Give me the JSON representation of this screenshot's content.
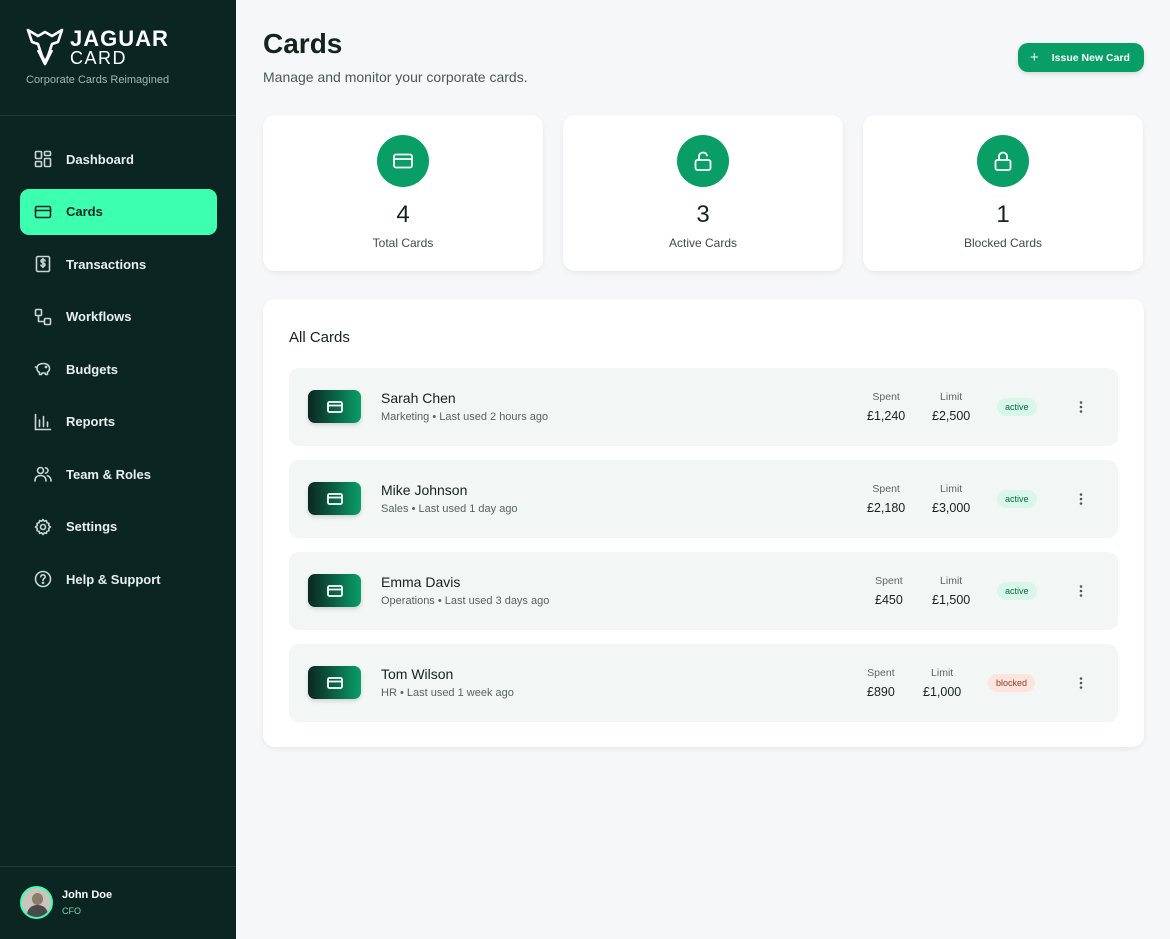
{
  "brand": {
    "name_line1": "JAGUAR",
    "name_line2": "CARD",
    "tagline": "Corporate Cards Reimagined"
  },
  "sidebar": {
    "items": [
      {
        "label": "Dashboard",
        "icon": "dashboard-icon",
        "active": false
      },
      {
        "label": "Cards",
        "icon": "credit-card-icon",
        "active": true
      },
      {
        "label": "Transactions",
        "icon": "receipt-dollar-icon",
        "active": false
      },
      {
        "label": "Workflows",
        "icon": "workflow-icon",
        "active": false
      },
      {
        "label": "Budgets",
        "icon": "piggy-bank-icon",
        "active": false
      },
      {
        "label": "Reports",
        "icon": "bar-chart-icon",
        "active": false
      },
      {
        "label": "Team & Roles",
        "icon": "users-icon",
        "active": false
      },
      {
        "label": "Settings",
        "icon": "gear-icon",
        "active": false
      },
      {
        "label": "Help & Support",
        "icon": "help-circle-icon",
        "active": false
      }
    ]
  },
  "user": {
    "name": "John Doe",
    "role": "CFO"
  },
  "header": {
    "title": "Cards",
    "subtitle": "Manage and monitor your corporate cards.",
    "issue_button": "Issue New Card",
    "issue_icon": "plus-icon"
  },
  "stats": [
    {
      "value": "4",
      "label": "Total Cards",
      "icon": "credit-card-icon"
    },
    {
      "value": "3",
      "label": "Active Cards",
      "icon": "unlock-icon"
    },
    {
      "value": "1",
      "label": "Blocked Cards",
      "icon": "lock-icon"
    }
  ],
  "all_cards": {
    "title": "All Cards",
    "spent_header": "Spent",
    "limit_header": "Limit",
    "rows": [
      {
        "name": "Sarah Chen",
        "meta": "Marketing • Last used 2 hours ago",
        "spent": "£1,240",
        "limit": "£2,500",
        "status": "active"
      },
      {
        "name": "Mike Johnson",
        "meta": "Sales • Last used 1 day ago",
        "spent": "£2,180",
        "limit": "£3,000",
        "status": "active"
      },
      {
        "name": "Emma Davis",
        "meta": "Operations • Last used 3 days ago",
        "spent": "£450",
        "limit": "£1,500",
        "status": "active"
      },
      {
        "name": "Tom Wilson",
        "meta": "HR • Last used 1 week ago",
        "spent": "£890",
        "limit": "£1,000",
        "status": "blocked"
      }
    ]
  },
  "colors": {
    "sidebar_bg": "#0b2622",
    "accent": "#3dffb0",
    "primary": "#0a9e67",
    "active_badge_bg": "#d9f7e8",
    "blocked_badge_bg": "#fde4dc"
  }
}
